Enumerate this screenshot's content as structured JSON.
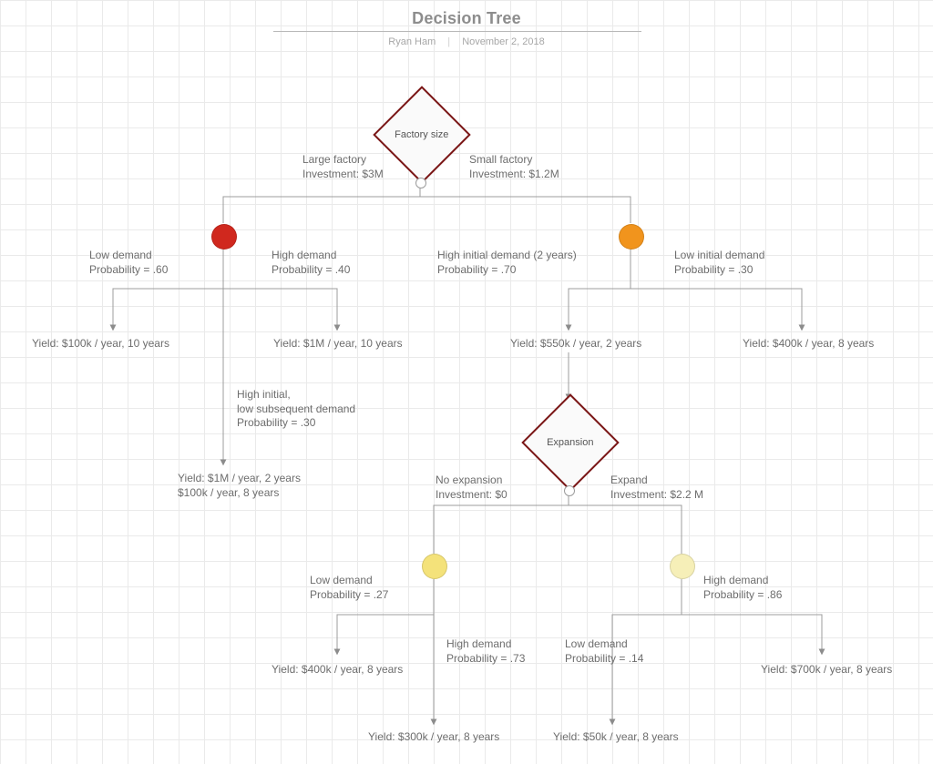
{
  "title": "Decision Tree",
  "author": "Ryan Ham",
  "date": "November 2, 2018",
  "root": {
    "label": "Factory size"
  },
  "rootBranches": {
    "left": {
      "line1": "Large factory",
      "line2": "Investment: $3M"
    },
    "right": {
      "line1": "Small factory",
      "line2": "Investment: $1.2M"
    }
  },
  "large": {
    "low": {
      "line1": "Low demand",
      "line2": "Probability = .60",
      "yield": "Yield: $100k / year, 10 years"
    },
    "high": {
      "line1": "High demand",
      "line2": "Probability = .40",
      "yield": "Yield: $1M / year, 10 years"
    },
    "mid": {
      "line1": "High initial,",
      "line2": "low subsequent demand",
      "line3": "Probability = .30",
      "yield1": "Yield: $1M / year, 2 years",
      "yield2": "$100k / year, 8 years"
    }
  },
  "small": {
    "highInit": {
      "line1": "High initial demand (2 years)",
      "line2": "Probability = .70",
      "yield": "Yield: $550k / year, 2 years"
    },
    "lowInit": {
      "line1": "Low initial demand",
      "line2": "Probability = .30",
      "yield": "Yield: $400k / year, 8 years"
    }
  },
  "expansion": {
    "label": "Expansion",
    "left": {
      "line1": "No expansion",
      "line2": "Investment: $0"
    },
    "right": {
      "line1": "Expand",
      "line2": "Investment: $2.2 M"
    }
  },
  "noexp": {
    "low": {
      "line1": "Low demand",
      "line2": "Probability = .27",
      "yield": "Yield: $400k / year, 8 years"
    },
    "high": {
      "line1": "High demand",
      "line2": "Probability = .73",
      "yield": "Yield: $300k / year, 8 years"
    }
  },
  "expand": {
    "low": {
      "line1": "Low demand",
      "line2": "Probability = .14",
      "yield": "Yield: $50k / year, 8 years"
    },
    "high": {
      "line1": "High demand",
      "line2": "Probability = .86",
      "yield": "Yield: $700k / year, 8 years"
    }
  }
}
